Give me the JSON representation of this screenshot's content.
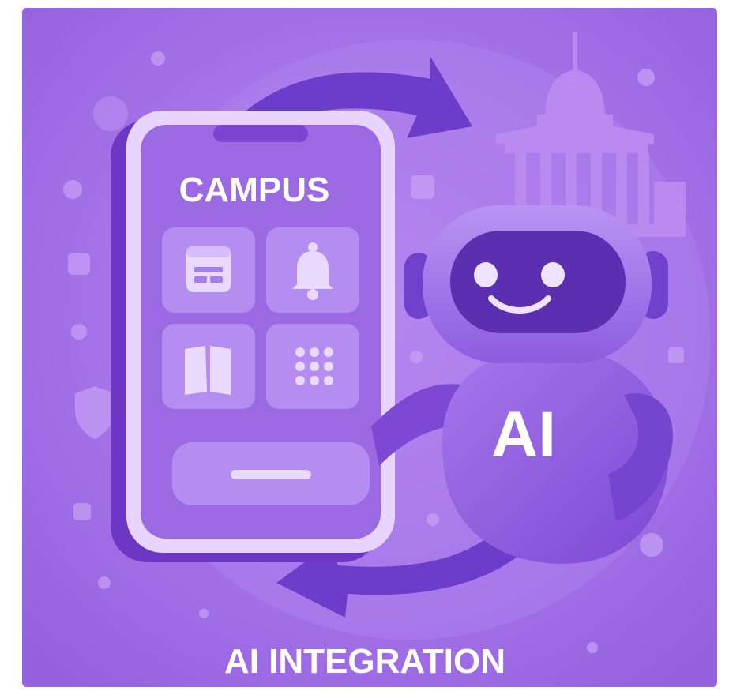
{
  "phone": {
    "title": "CAMPUS",
    "tiles": [
      {
        "icon": "calendar-icon"
      },
      {
        "icon": "bell-icon"
      },
      {
        "icon": "book-icon"
      },
      {
        "icon": "grid-icon"
      }
    ],
    "button_label": ""
  },
  "robot": {
    "badge": "AI"
  },
  "caption": "AI INTEGRATION",
  "colors": {
    "background": "#a070e6",
    "phone_frame": "#e9d4ff",
    "phone_screen": "#9b6ae3",
    "tile": "#b58cf0",
    "robot_body": "#8a56dc",
    "robot_visor": "#5b2fb0",
    "arrow": "#6a3ac8",
    "text": "#ffffff"
  }
}
